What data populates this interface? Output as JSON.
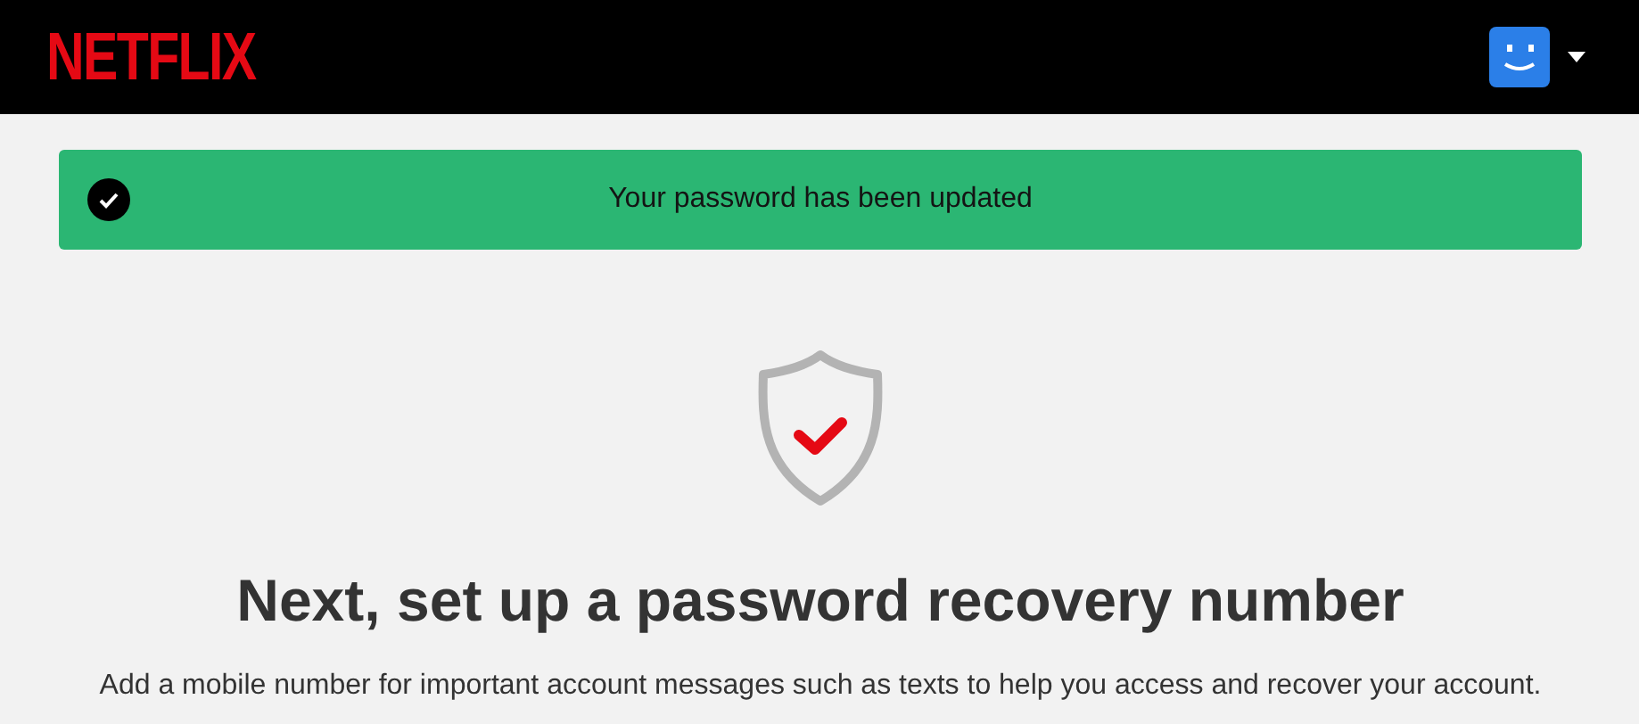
{
  "header": {
    "logo": "NETFLIX"
  },
  "banner": {
    "message": "Your password has been updated"
  },
  "title": "Next, set up a password recovery number",
  "description": "Add a mobile number for important account messages such as texts to help you access and recover your account."
}
